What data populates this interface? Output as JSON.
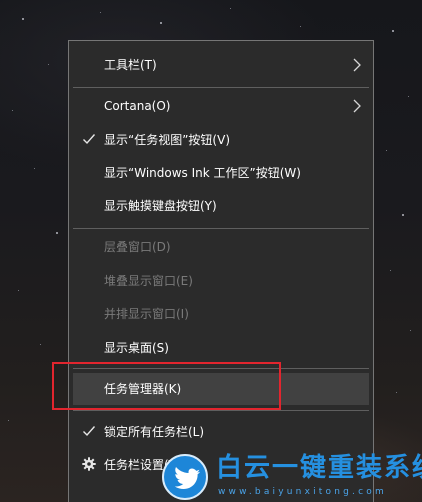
{
  "menu": {
    "items": [
      {
        "label": "工具栏(T)"
      },
      {
        "label": "Cortana(O)"
      },
      {
        "label": "显示“任务视图”按钮(V)"
      },
      {
        "label": "显示“Windows Ink 工作区”按钮(W)"
      },
      {
        "label": "显示触摸键盘按钮(Y)"
      },
      {
        "label": "层叠窗口(D)"
      },
      {
        "label": "堆叠显示窗口(E)"
      },
      {
        "label": "并排显示窗口(I)"
      },
      {
        "label": "显示桌面(S)"
      },
      {
        "label": "任务管理器(K)"
      },
      {
        "label": "锁定所有任务栏(L)"
      },
      {
        "label": "任务栏设置(T)"
      }
    ]
  },
  "watermark": {
    "title": "白云一键重装系统",
    "url": "www.baiyunxitong.com"
  },
  "colors": {
    "menu_background": "#2b2b2b",
    "menu_border": "#767676",
    "highlight": "#414141",
    "disabled_text": "#7a7a7a",
    "annotation_red": "#e2252e",
    "watermark_blue": "#2590e0"
  },
  "icons": {
    "submenu": "chevron-right-icon",
    "checked": "checkmark-icon",
    "settings": "gear-icon",
    "watermark_logo": "bird-logo-icon"
  }
}
